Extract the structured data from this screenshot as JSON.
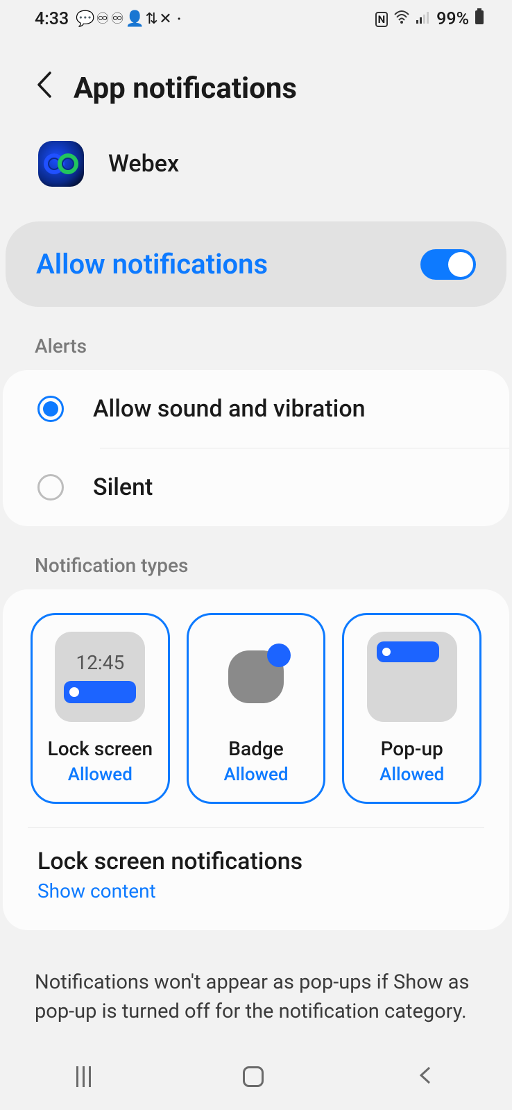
{
  "status": {
    "time": "4:33",
    "battery": "99%"
  },
  "header": {
    "title": "App notifications"
  },
  "app": {
    "name": "Webex"
  },
  "allow": {
    "label": "Allow notifications",
    "enabled": true
  },
  "sections": {
    "alerts": "Alerts",
    "types": "Notification types"
  },
  "alerts": {
    "options": [
      {
        "label": "Allow sound and vibration",
        "selected": true
      },
      {
        "label": "Silent",
        "selected": false
      }
    ]
  },
  "types": [
    {
      "key": "lock",
      "title": "Lock screen",
      "status": "Allowed",
      "preview_time": "12:45"
    },
    {
      "key": "badge",
      "title": "Badge",
      "status": "Allowed"
    },
    {
      "key": "popup",
      "title": "Pop-up",
      "status": "Allowed"
    }
  ],
  "lockscreen_row": {
    "title": "Lock screen notifications",
    "subtitle": "Show content"
  },
  "footer_note": "Notifications won't appear as pop-ups if Show as pop-up is turned off for the notification category.",
  "colors": {
    "accent": "#0d7aff"
  }
}
